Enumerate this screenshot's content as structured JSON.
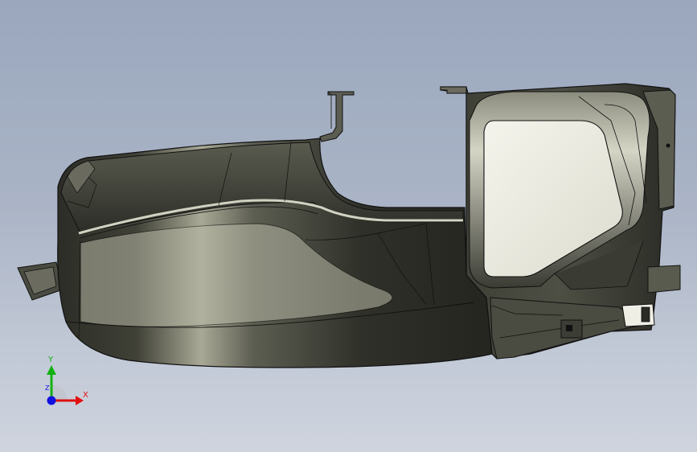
{
  "viewport": {
    "model_name": "",
    "colors": {
      "background_top": "#9aa7bd",
      "background_bottom": "#cfd4de",
      "part_dark": "#2a2b24",
      "part_mid": "#55564a",
      "part_highlight": "#cfcfc0",
      "edge": "#101010",
      "inner_light": "#eaeae0"
    }
  },
  "triad": {
    "x_label": "X",
    "y_label": "Y",
    "z_label": "Z",
    "x_color": "#e01010",
    "y_color": "#10b010",
    "z_color": "#1010e0"
  }
}
